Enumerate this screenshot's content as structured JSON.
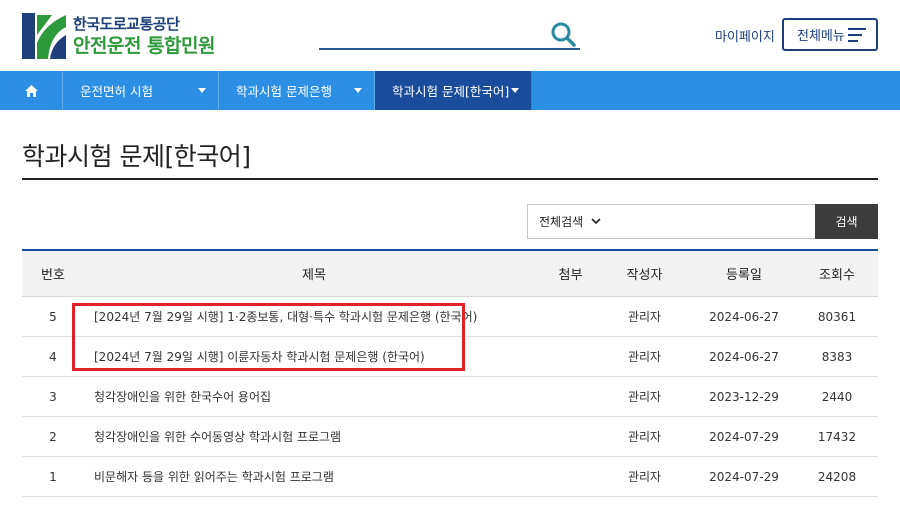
{
  "header": {
    "logo_line1": "한국도로교통공단",
    "logo_line2": "안전운전 통합민원",
    "mypage_label": "마이페이지",
    "all_menu_label": "전체메뉴"
  },
  "search_top": {
    "placeholder": ""
  },
  "nav": {
    "items": [
      {
        "label": "운전면허 시험"
      },
      {
        "label": "학과시험 문제은행"
      },
      {
        "label": "학과시험 문제[한국어]"
      }
    ]
  },
  "page": {
    "title": "학과시험 문제[한국어]"
  },
  "board_search": {
    "select_value": "전체검색",
    "input_value": "",
    "button_label": "검색"
  },
  "table": {
    "headers": {
      "num": "번호",
      "title": "제목",
      "attach": "첨부",
      "author": "작성자",
      "date": "등록일",
      "views": "조회수"
    },
    "rows": [
      {
        "num": "5",
        "title": "[2024년 7월 29일 시행] 1·2종보통, 대형·특수 학과시험 문제은행 (한국어)",
        "attach": "",
        "author": "관리자",
        "date": "2024-06-27",
        "views": "80361"
      },
      {
        "num": "4",
        "title": "[2024년 7월 29일 시행] 이륜자동차 학과시험 문제은행 (한국어)",
        "attach": "",
        "author": "관리자",
        "date": "2024-06-27",
        "views": "8383"
      },
      {
        "num": "3",
        "title": "청각장애인을 위한 한국수어 용어집",
        "attach": "",
        "author": "관리자",
        "date": "2023-12-29",
        "views": "2440"
      },
      {
        "num": "2",
        "title": "청각장애인을 위한 수어동영상 학과시험 프로그램",
        "attach": "",
        "author": "관리자",
        "date": "2024-07-29",
        "views": "17432"
      },
      {
        "num": "1",
        "title": "비문해자 등을 위한 읽어주는 학과시험 프로그램",
        "attach": "",
        "author": "관리자",
        "date": "2024-07-29",
        "views": "24208"
      }
    ]
  },
  "colors": {
    "nav_bg": "#2b8fe6",
    "nav_active": "#1a4c9c",
    "highlight": "#e0222a",
    "brand_green": "#2e9a3b",
    "brand_blue": "#1e3f7a"
  }
}
